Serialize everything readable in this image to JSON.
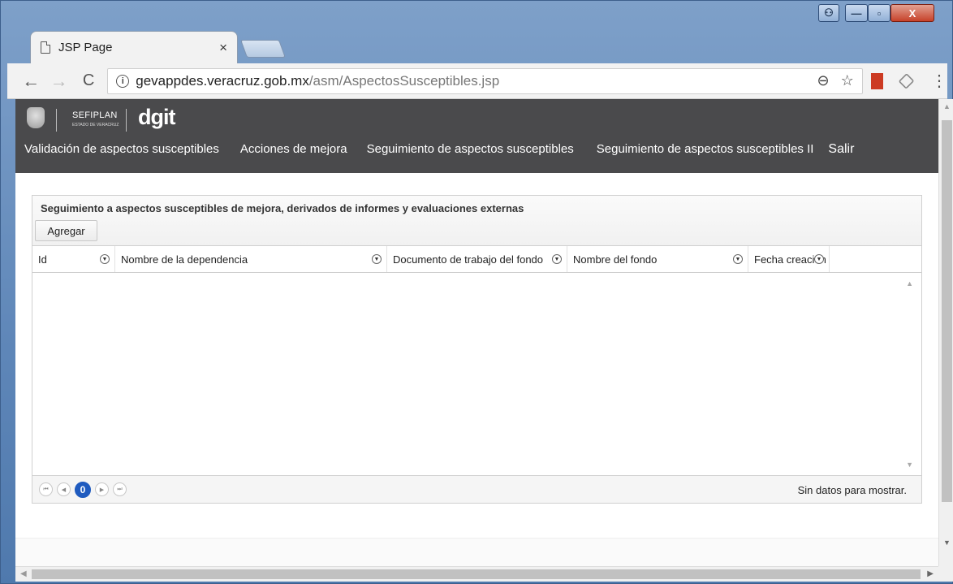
{
  "browser": {
    "tab_title": "JSP Page",
    "tab_close": "×",
    "url_host": "gevappdes.veracruz.gob.mx",
    "url_path": "/asm/AspectosSusceptibles.jsp",
    "info_glyph": "i",
    "back_glyph": "←",
    "forward_glyph": "→",
    "reload_glyph": "C",
    "zoom_glyph": "⊖",
    "star_glyph": "☆",
    "menu_glyph": "⋮"
  },
  "window_controls": {
    "min": "—",
    "max": "▫",
    "close": "X"
  },
  "header": {
    "sefiplan": "SEFIPLAN",
    "sefiplan_sub": "ESTADO DE VERACRUZ",
    "dgit": "dgit",
    "nav": [
      "Validación de aspectos susceptibles",
      "Acciones de mejora",
      "Seguimiento de aspectos susceptibles",
      "Seguimiento de aspectos susceptibles II",
      "Salir"
    ]
  },
  "panel": {
    "title": "Seguimiento a aspectos susceptibles de mejora, derivados de informes y evaluaciones externas",
    "add_button": "Agregar",
    "columns": [
      "Id",
      "Nombre de la dependencia",
      "Documento de trabajo del fondo",
      "Nombre del fondo",
      "Fecha creación"
    ],
    "filter_glyph": "▼",
    "pager": {
      "first": "⏮",
      "prev": "◀",
      "current": "0",
      "next": "▶",
      "last": "⏭"
    },
    "empty_message": "Sin datos para mostrar."
  },
  "colors": {
    "header_bg": "#4a4a4c",
    "pager_active": "#1f5bbf"
  }
}
